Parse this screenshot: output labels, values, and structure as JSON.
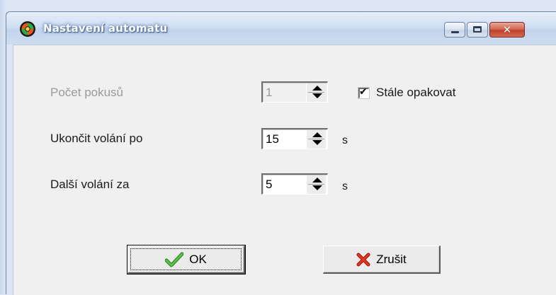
{
  "window": {
    "title": "Nastavení automatu",
    "icon": "app-icon-orange-green-circle"
  },
  "caption_buttons": {
    "minimize_icon": "minimize-icon",
    "maximize_icon": "maximize-icon",
    "close_icon": "close-icon",
    "close_glyph": "✕"
  },
  "form": {
    "attempts": {
      "label": "Počet pokusů",
      "value": "1",
      "disabled": true
    },
    "repeat_always": {
      "label": "Stále opakovat",
      "checked": true,
      "check_glyph": "✔"
    },
    "end_call_after": {
      "label": "Ukončit volání po",
      "value": "15",
      "unit": "s"
    },
    "next_call_in": {
      "label": "Další volání za",
      "value": "5",
      "unit": "s"
    }
  },
  "buttons": {
    "ok": {
      "label": "OK",
      "icon": "checkmark-icon"
    },
    "cancel": {
      "label": "Zrušit",
      "icon": "red-x-icon"
    }
  },
  "colors": {
    "title_gradient_top": "#e7eef9",
    "close_button": "#c2412a",
    "ok_check": "#3aa52e",
    "cancel_x": "#d42a1a",
    "disabled_text": "#9a9a9a"
  }
}
